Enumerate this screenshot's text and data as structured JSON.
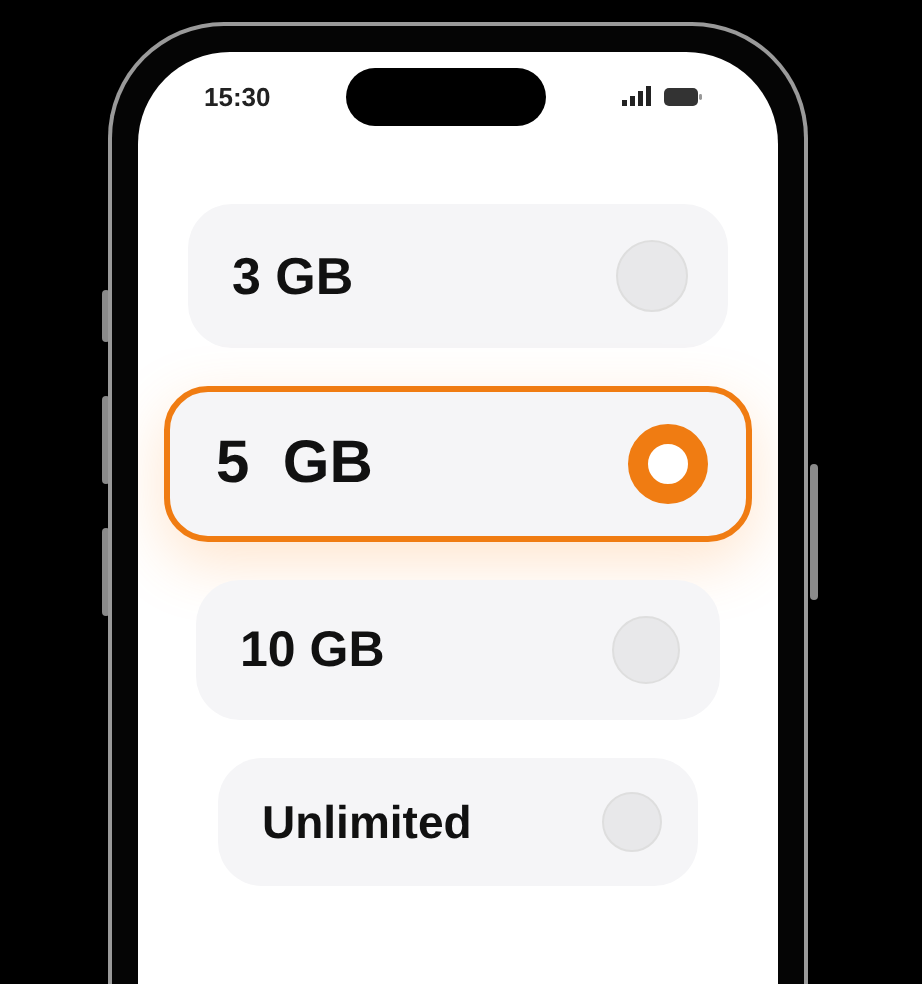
{
  "status_bar": {
    "time": "15:30"
  },
  "options": [
    {
      "label": "3 GB",
      "selected": false
    },
    {
      "label": "5  GB",
      "selected": true
    },
    {
      "label": "10 GB",
      "selected": false
    },
    {
      "label": "Unlimited",
      "selected": false
    }
  ]
}
